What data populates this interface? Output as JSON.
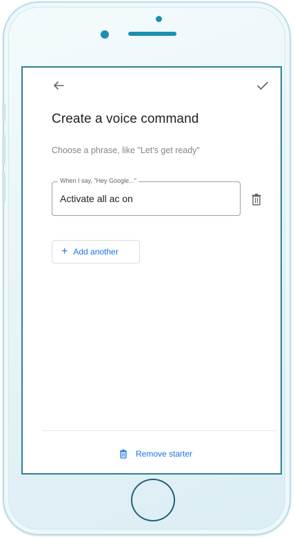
{
  "header": {
    "back_icon": "arrow-left-icon",
    "confirm_icon": "check-icon"
  },
  "page": {
    "title": "Create a voice command",
    "subtitle": "Choose a phrase, like \"Let's get ready\""
  },
  "command_field": {
    "label": "When I say, \"Hey Google...\"",
    "value": "Activate all ac on",
    "delete_icon": "trash-icon"
  },
  "actions": {
    "add_another_label": "Add another",
    "add_icon": "plus-icon"
  },
  "footer": {
    "remove_starter_label": "Remove starter",
    "remove_icon": "trash-icon"
  },
  "colors": {
    "accent": "#1a73e8",
    "frame_accent": "#1b8fb1",
    "screen_border": "#2f7f96",
    "text_primary": "#202124",
    "text_secondary": "#80868b"
  }
}
